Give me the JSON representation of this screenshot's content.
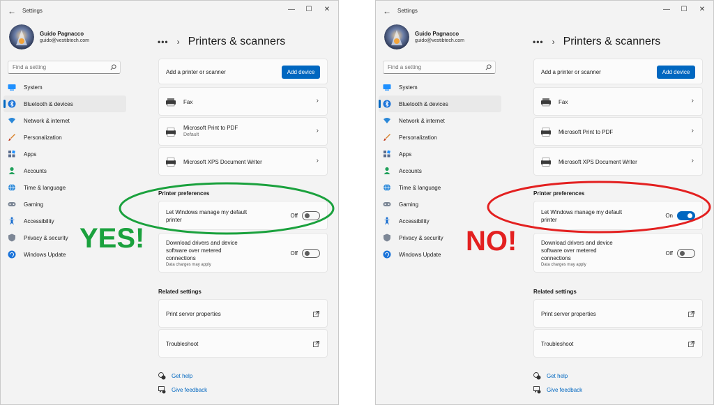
{
  "panels": [
    {
      "app_title": "Settings",
      "profile": {
        "name": "Guido Pagnacco",
        "email": "guido@vestibtech.com"
      },
      "search_placeholder": "Find a setting",
      "nav": [
        {
          "label": "System",
          "icon": "system-icon",
          "active": false
        },
        {
          "label": "Bluetooth & devices",
          "icon": "bluetooth-icon",
          "active": true
        },
        {
          "label": "Network & internet",
          "icon": "wifi-icon",
          "active": false
        },
        {
          "label": "Personalization",
          "icon": "brush-icon",
          "active": false
        },
        {
          "label": "Apps",
          "icon": "apps-icon",
          "active": false
        },
        {
          "label": "Accounts",
          "icon": "person-icon",
          "active": false
        },
        {
          "label": "Time & language",
          "icon": "globe-clock-icon",
          "active": false
        },
        {
          "label": "Gaming",
          "icon": "gamepad-icon",
          "active": false
        },
        {
          "label": "Accessibility",
          "icon": "accessibility-icon",
          "active": false
        },
        {
          "label": "Privacy & security",
          "icon": "shield-icon",
          "active": false
        },
        {
          "label": "Windows Update",
          "icon": "update-icon",
          "active": false
        }
      ],
      "breadcrumb_more": "•••",
      "breadcrumb_sep": "›",
      "page_title": "Printers & scanners",
      "add_printer_label": "Add a printer or scanner",
      "add_device_button": "Add device",
      "devices": [
        {
          "name": "Fax",
          "sub": ""
        },
        {
          "name": "Microsoft Print to PDF",
          "sub": "Default"
        },
        {
          "name": "Microsoft XPS Document Writer",
          "sub": ""
        }
      ],
      "printer_prefs_title": "Printer preferences",
      "manage_default": {
        "label": "Let Windows manage my default printer",
        "state_text": "Off",
        "on": false
      },
      "metered": {
        "label": "Download drivers and device software over metered connections",
        "note": "Data charges may apply",
        "state_text": "Off",
        "on": false
      },
      "related_title": "Related settings",
      "related": [
        "Print server properties",
        "Troubleshoot"
      ],
      "footer": [
        {
          "label": "Get help",
          "icon": "help-icon"
        },
        {
          "label": "Give feedback",
          "icon": "feedback-icon"
        }
      ],
      "verdict": {
        "text": "YES!",
        "color": "#1aa13d"
      },
      "ellipse_color": "#1aa13d"
    },
    {
      "app_title": "Settings",
      "profile": {
        "name": "Guido Pagnacco",
        "email": "guido@vestibtech.com"
      },
      "search_placeholder": "Find a setting",
      "nav": [
        {
          "label": "System",
          "icon": "system-icon",
          "active": false
        },
        {
          "label": "Bluetooth & devices",
          "icon": "bluetooth-icon",
          "active": true
        },
        {
          "label": "Network & internet",
          "icon": "wifi-icon",
          "active": false
        },
        {
          "label": "Personalization",
          "icon": "brush-icon",
          "active": false
        },
        {
          "label": "Apps",
          "icon": "apps-icon",
          "active": false
        },
        {
          "label": "Accounts",
          "icon": "person-icon",
          "active": false
        },
        {
          "label": "Time & language",
          "icon": "globe-clock-icon",
          "active": false
        },
        {
          "label": "Gaming",
          "icon": "gamepad-icon",
          "active": false
        },
        {
          "label": "Accessibility",
          "icon": "accessibility-icon",
          "active": false
        },
        {
          "label": "Privacy & security",
          "icon": "shield-icon",
          "active": false
        },
        {
          "label": "Windows Update",
          "icon": "update-icon",
          "active": false
        }
      ],
      "breadcrumb_more": "•••",
      "breadcrumb_sep": "›",
      "page_title": "Printers & scanners",
      "add_printer_label": "Add a printer or scanner",
      "add_device_button": "Add device",
      "devices": [
        {
          "name": "Fax",
          "sub": ""
        },
        {
          "name": "Microsoft Print to PDF",
          "sub": ""
        },
        {
          "name": "Microsoft XPS Document Writer",
          "sub": ""
        }
      ],
      "printer_prefs_title": "Printer preferences",
      "manage_default": {
        "label": "Let Windows manage my default printer",
        "state_text": "On",
        "on": true
      },
      "metered": {
        "label": "Download drivers and device software over metered connections",
        "note": "Data charges may apply",
        "state_text": "Off",
        "on": false
      },
      "related_title": "Related settings",
      "related": [
        "Print server properties",
        "Troubleshoot"
      ],
      "footer": [
        {
          "label": "Get help",
          "icon": "help-icon"
        },
        {
          "label": "Give feedback",
          "icon": "feedback-icon"
        }
      ],
      "verdict": {
        "text": "NO!",
        "color": "#e32020"
      },
      "ellipse_color": "#e32020"
    }
  ],
  "colors": {
    "accent": "#0067c0",
    "window_bg": "#f3f3f3",
    "card_bg": "#fbfbfb"
  }
}
